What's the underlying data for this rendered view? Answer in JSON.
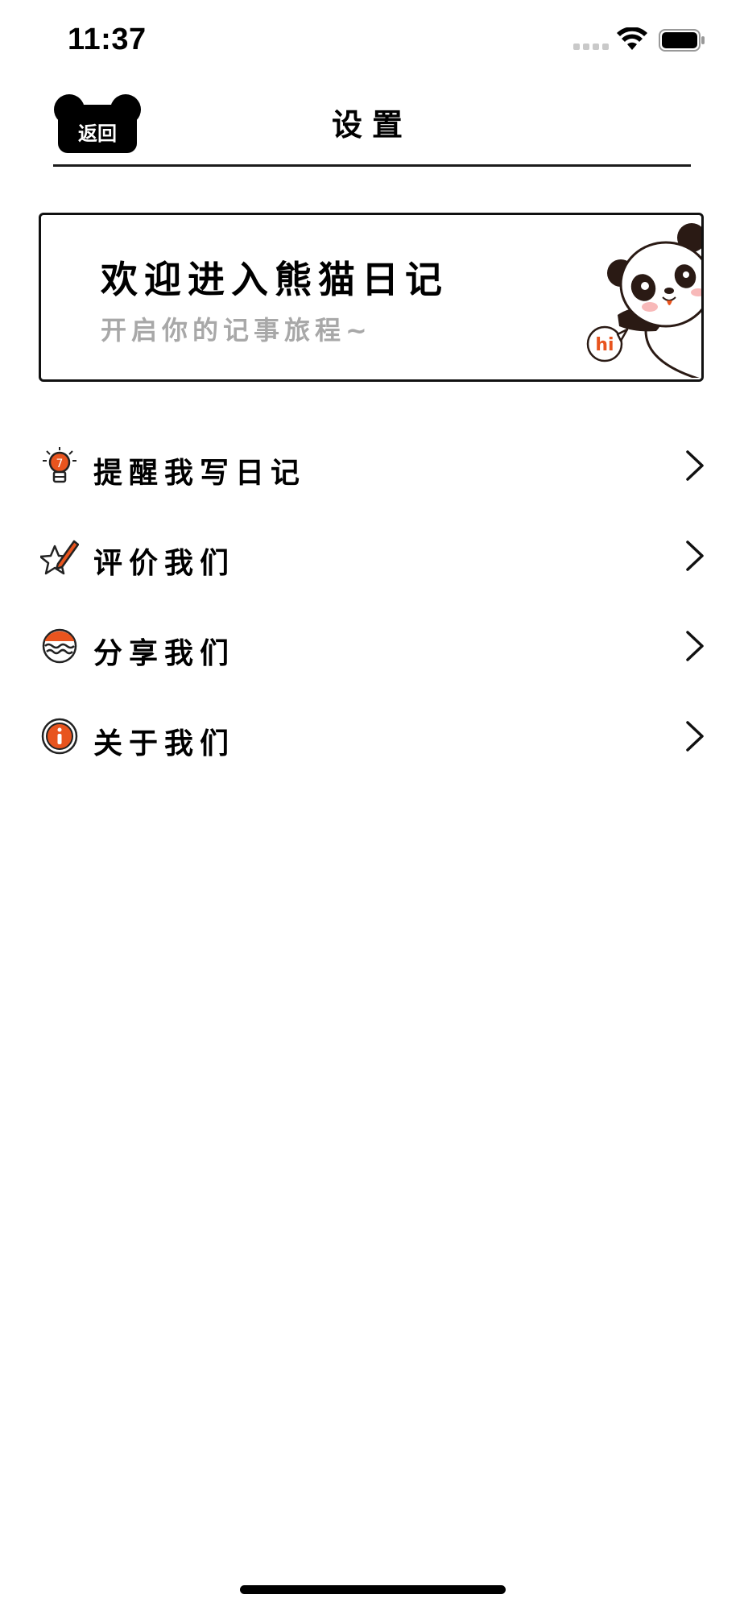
{
  "status_bar": {
    "time": "11:37"
  },
  "nav": {
    "back_label": "返回",
    "title": "设置"
  },
  "banner": {
    "title": "欢迎进入熊猫日记",
    "subtitle": "开启你的记事旅程~",
    "badge_text": "hi"
  },
  "menu": {
    "items": [
      {
        "label": "提醒我写日记",
        "icon": "lightbulb-icon"
      },
      {
        "label": "评价我们",
        "icon": "star-pencil-icon"
      },
      {
        "label": "分享我们",
        "icon": "share-wave-icon"
      },
      {
        "label": "关于我们",
        "icon": "info-icon"
      }
    ]
  },
  "colors": {
    "accent": "#e8541e",
    "text": "#000000",
    "subtitle": "#a8a8a8",
    "divider": "#1b1b1b"
  }
}
